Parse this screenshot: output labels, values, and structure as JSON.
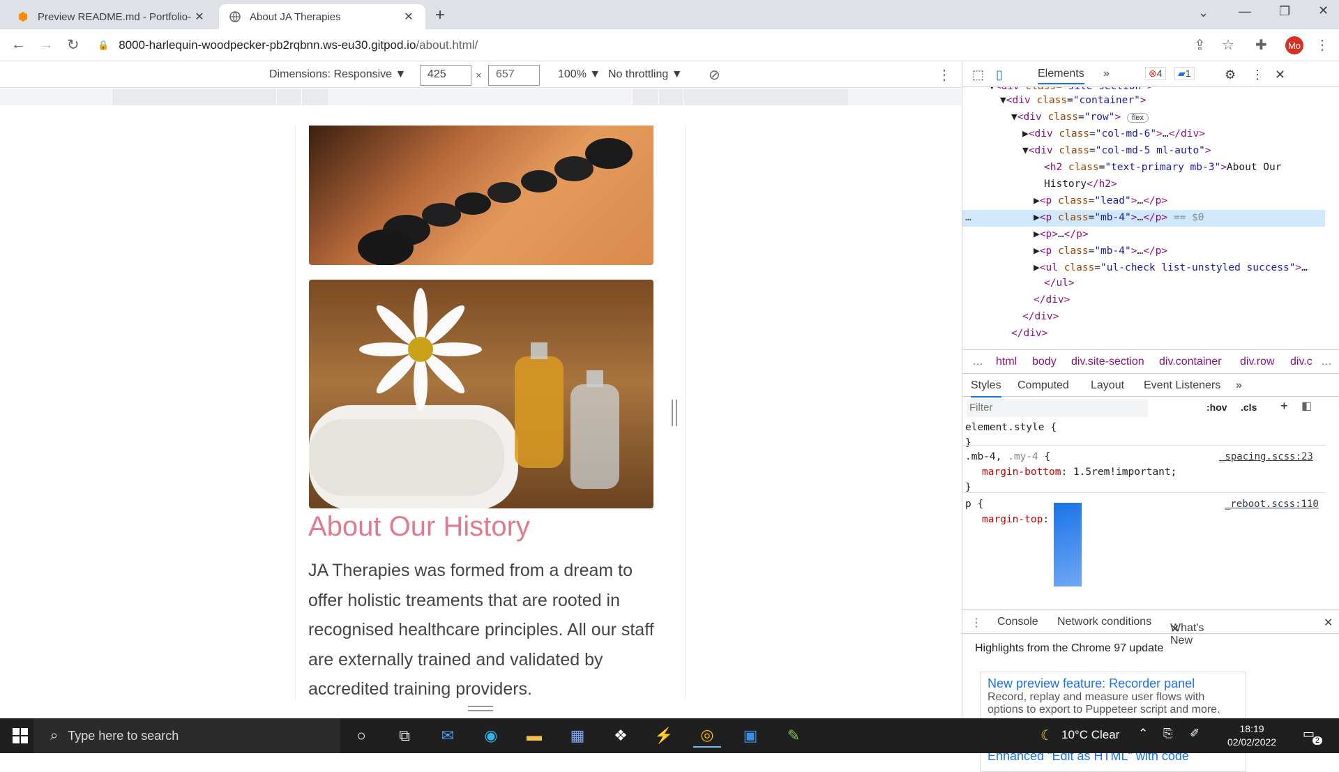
{
  "browser": {
    "tabs": [
      {
        "title": "Preview README.md - Portfolio-",
        "icon": "gitpod-icon"
      },
      {
        "title": "About JA Therapies",
        "icon": "globe-icon"
      }
    ],
    "url_host": "8000-harlequin-woodpecker-pb2rqbnn.ws-eu30.gitpod.io",
    "url_path": "/about.html/",
    "avatar_initials": "Mo"
  },
  "device_toolbar": {
    "dimensions_label": "Dimensions: Responsive",
    "width": "425",
    "height": "657",
    "zoom": "100%",
    "throttling": "No throttling"
  },
  "page": {
    "heading": "About Our History",
    "paragraph": "JA Therapies was formed from a dream to offer holistic treaments that are rooted in recognised healthcare principles. All our staff are externally trained and validated by accredited training providers.",
    "accent_color": "#e07b8e"
  },
  "devtools": {
    "active_tab": "Elements",
    "errors": "4",
    "messages": "1",
    "breadcrumbs": [
      "html",
      "body",
      "div.site-section",
      "div.container",
      "div.row",
      "div.c"
    ],
    "style_tabs": [
      "Styles",
      "Computed",
      "Layout",
      "Event Listeners"
    ],
    "filter_placeholder": "Filter",
    "hov": ":hov",
    "cls": ".cls",
    "drawer_tabs": [
      "Console",
      "Network conditions",
      "What's New"
    ],
    "highlights": "Highlights from the Chrome 97 update",
    "cards": [
      {
        "title": "New preview feature: Recorder panel",
        "desc": "Record, replay and measure user flows with options to export to Puppeteer script and more."
      },
      {
        "title": "Enhanced \"Edit as HTML\" with code",
        "desc": ""
      }
    ]
  },
  "taskbar": {
    "search_placeholder": "Type here to search",
    "weather": "10°C  Clear",
    "time": "18:19",
    "date": "02/02/2022",
    "notifications": "2"
  }
}
